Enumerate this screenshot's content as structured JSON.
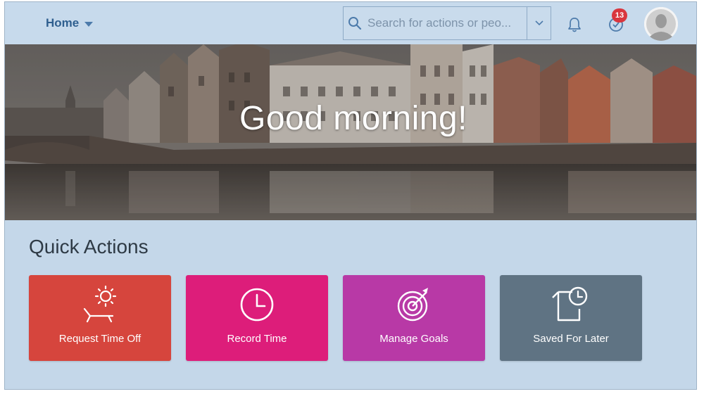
{
  "header": {
    "home_label": "Home",
    "search": {
      "placeholder": "Search for actions or peo..."
    },
    "notifications_icon": "bell-icon",
    "tasks_icon": "tasks-icon",
    "tasks_badge_count": "13",
    "avatar_icon": "user-avatar-icon"
  },
  "hero": {
    "greeting": "Good morning!"
  },
  "quick_actions": {
    "title": "Quick Actions",
    "tiles": [
      {
        "label": "Request Time Off",
        "icon": "beach-sun-icon",
        "color": "#d6453d"
      },
      {
        "label": "Record Time",
        "icon": "clock-icon",
        "color": "#dd1d7a"
      },
      {
        "label": "Manage Goals",
        "icon": "target-icon",
        "color": "#b839a6"
      },
      {
        "label": "Saved For Later",
        "icon": "document-clock-icon",
        "color": "#5f7383"
      }
    ]
  },
  "colors": {
    "page_background": "#c4d7e9",
    "nav_text": "#2f5f8f",
    "badge": "#d9363e"
  }
}
